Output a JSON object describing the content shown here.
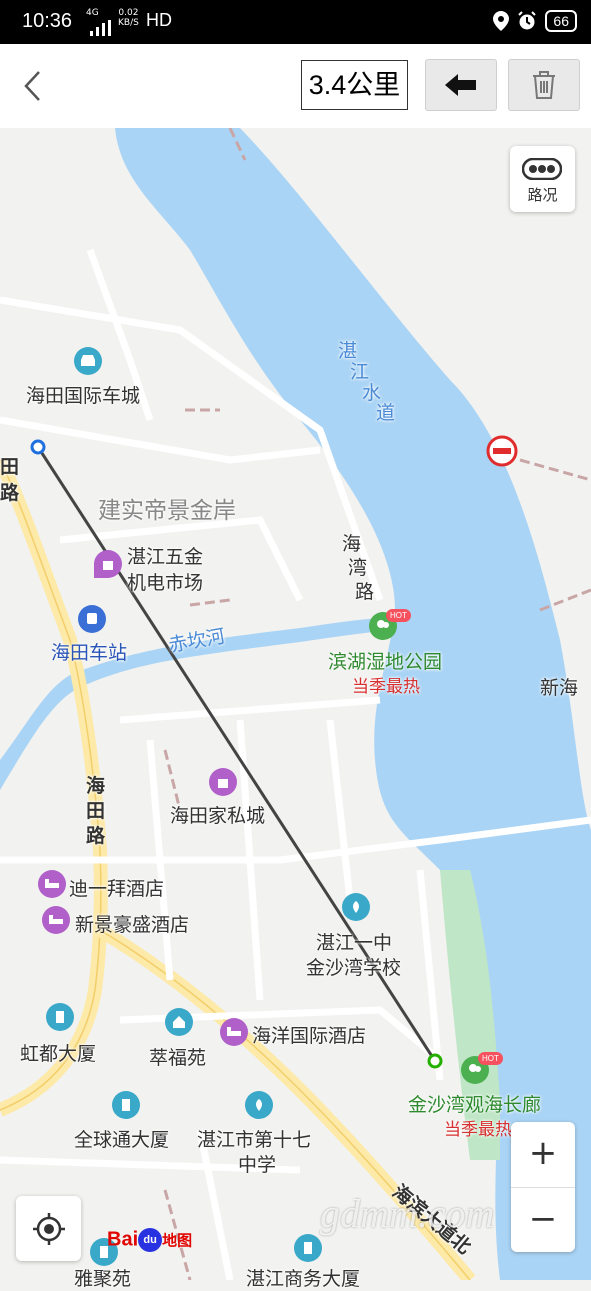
{
  "status_bar": {
    "time": "10:36",
    "network": "4G",
    "speed_value": "0.02",
    "speed_unit": "KB/S",
    "hd": "HD",
    "battery": "66"
  },
  "toolbar": {
    "distance": "3.4公里"
  },
  "map": {
    "labels": {
      "haitian_car_city": "海田国际车城",
      "jianshi": "建实帝景金岸",
      "wujin_1": "湛江五金",
      "wujin_2": "机电市场",
      "haitian_station": "海田车站",
      "chikan_river": "赤坎河",
      "binhu_park": "滨湖湿地公园",
      "binhu_sub": "当季最热",
      "xinhai": "新海",
      "haitian_road_v1": "海",
      "haitian_road_v2": "田",
      "haitian_road_v3": "路",
      "haitian_road_top_1": "田",
      "haitian_road_top_2": "路",
      "haitian_furniture": "海田家私城",
      "dieyibai_hotel": "迪一拜酒店",
      "xinjing_hotel": "新景豪盛酒店",
      "no1_school_1": "湛江一中",
      "no1_school_2": "金沙湾学校",
      "hongdu": "虹都大厦",
      "cuifu": "萃福苑",
      "haiyang_hotel": "海洋国际酒店",
      "jinshawan_1": "金沙湾观海长廊",
      "jinshawan_sub": "当季最热",
      "quanqiutong": "全球通大厦",
      "no17_school_1": "湛江市第十七",
      "no17_school_2": "中学",
      "haiwan_road_1": "海",
      "haiwan_road_2": "湾",
      "haiwan_road_3": "路",
      "water_channel_1": "湛",
      "water_channel_2": "江",
      "water_channel_3": "水",
      "water_channel_4": "道",
      "haibin_ave": "海滨大道北",
      "bottom_1": "雅聚苑",
      "bottom_2": "湛江商务大厦",
      "hot": "HOT"
    }
  },
  "controls": {
    "traffic": "路况",
    "zoom_in": "+",
    "zoom_out": "−"
  },
  "brand": {
    "baidu": "Bai",
    "du": "du",
    "ditu": "地图"
  },
  "watermark": "gdmm.com"
}
